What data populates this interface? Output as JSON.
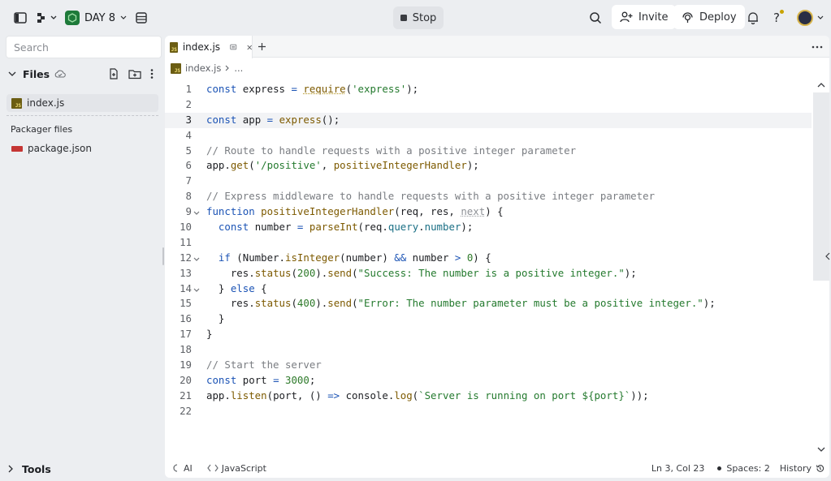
{
  "topbar": {
    "project_name": "DAY 8",
    "stop_label": "Stop",
    "invite_label": "Invite",
    "deploy_label": "Deploy"
  },
  "sidebar": {
    "search_placeholder": "Search",
    "files_label": "Files",
    "files": [
      {
        "name": "index.js",
        "type": "js"
      }
    ],
    "packager_label": "Packager files",
    "packager_files": [
      {
        "name": "package.json",
        "type": "npm"
      }
    ],
    "tools_label": "Tools"
  },
  "editor": {
    "tab_label": "index.js",
    "breadcrumb_file": "index.js",
    "breadcrumb_more": "...",
    "current_line": 3,
    "line_numbers": [
      "1",
      "2",
      "3",
      "4",
      "5",
      "6",
      "7",
      "8",
      "9",
      "10",
      "11",
      "12",
      "13",
      "14",
      "15",
      "16",
      "17",
      "18",
      "19",
      "20",
      "21",
      "22"
    ],
    "lines": [
      "const express = require('express');",
      "",
      "const app = express();",
      "",
      "// Route to handle requests with a positive integer parameter",
      "app.get('/positive', positiveIntegerHandler);",
      "",
      "// Express middleware to handle requests with a positive integer parameter",
      "function positiveIntegerHandler(req, res, next) {",
      "  const number = parseInt(req.query.number);",
      "",
      "  if (Number.isInteger(number) && number > 0) {",
      "    res.status(200).send(\"Success: The number is a positive integer.\");",
      "  } else {",
      "    res.status(400).send(\"Error: The number parameter must be a positive integer.\");",
      "  }",
      "}",
      "",
      "// Start the server",
      "const port = 3000;",
      "app.listen(port, () => console.log(`Server is running on port ${port}`));",
      ""
    ]
  },
  "statusbar": {
    "ai_label": "AI",
    "language": "JavaScript",
    "cursor_position": "Ln 3, Col 23",
    "spaces": "Spaces: 2",
    "history_label": "History"
  }
}
